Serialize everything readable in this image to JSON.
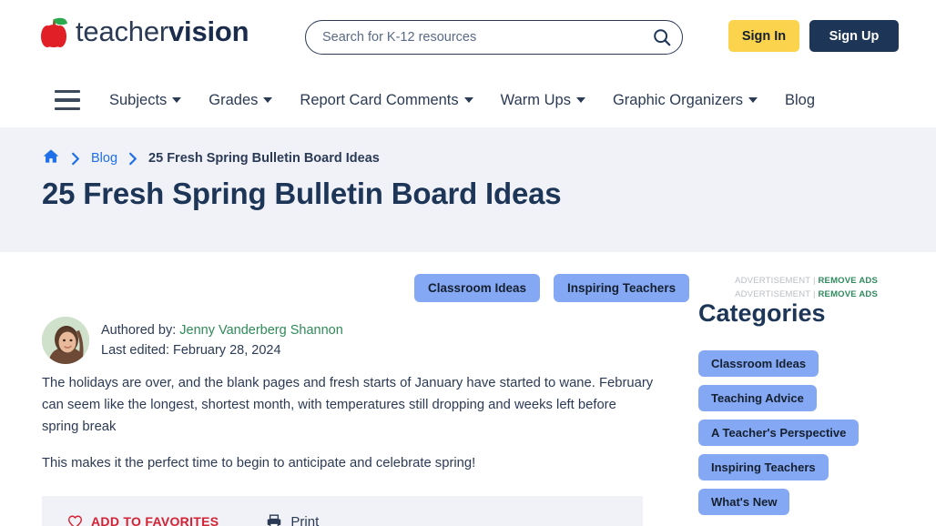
{
  "header": {
    "logo": {
      "part1": "teacher",
      "part2": "vision",
      "icon": "apple-icon"
    },
    "search": {
      "placeholder": "Search for K-12 resources",
      "value": "",
      "icon": "search-icon"
    },
    "sign_in_label": "Sign In",
    "sign_up_label": "Sign Up",
    "colors": {
      "sign_in_bg": "#fbd34d",
      "sign_up_bg": "#1d3557",
      "navy": "#1d3557"
    }
  },
  "nav": {
    "menu_icon": "hamburger-icon",
    "items": [
      {
        "label": "Subjects",
        "has_caret": true
      },
      {
        "label": "Grades",
        "has_caret": true
      },
      {
        "label": "Report Card Comments",
        "has_caret": true
      },
      {
        "label": "Warm Ups",
        "has_caret": true
      },
      {
        "label": "Graphic Organizers",
        "has_caret": true
      },
      {
        "label": "Blog",
        "has_caret": false
      }
    ]
  },
  "hero": {
    "breadcrumb": {
      "home_icon": "home-icon",
      "separator": "chevron-right-icon",
      "items": [
        {
          "label": "Blog",
          "type": "link"
        },
        {
          "label": "25 Fresh Spring Bulletin Board Ideas",
          "type": "current"
        }
      ]
    },
    "title": "25 Fresh Spring Bulletin Board Ideas"
  },
  "article": {
    "tags": [
      "Classroom Ideas",
      "Inspiring Teachers"
    ],
    "author": {
      "authored_by_label": "Authored by:",
      "author_name": "Jenny Vanderberg Shannon",
      "last_edited_label": "Last edited:",
      "last_edited_date": "February 28, 2024",
      "avatar": "author-avatar"
    },
    "paragraphs": [
      "The holidays are over, and the blank pages and fresh starts of January have started to wane. February can seem like the longest, shortest month, with temperatures still dropping and weeks left before spring break",
      "This makes it the perfect time to begin to anticipate and celebrate spring!"
    ],
    "actions": [
      {
        "label": "ADD TO FAVORITES",
        "icon": "heart-icon",
        "color": "#d32233"
      },
      {
        "label": "Print",
        "icon": "printer-icon",
        "color": "#2b3a55"
      }
    ]
  },
  "sidebar": {
    "ads": [
      {
        "label": "ADVERTISEMENT",
        "separator": "|",
        "remove_label": "REMOVE ADS"
      },
      {
        "label": "ADVERTISEMENT",
        "separator": "|",
        "remove_label": "REMOVE ADS"
      }
    ],
    "title": "Categories",
    "categories": [
      "Classroom Ideas",
      "Teaching Advice",
      "A Teacher's Perspective",
      "Inspiring Teachers",
      "What's New"
    ]
  }
}
